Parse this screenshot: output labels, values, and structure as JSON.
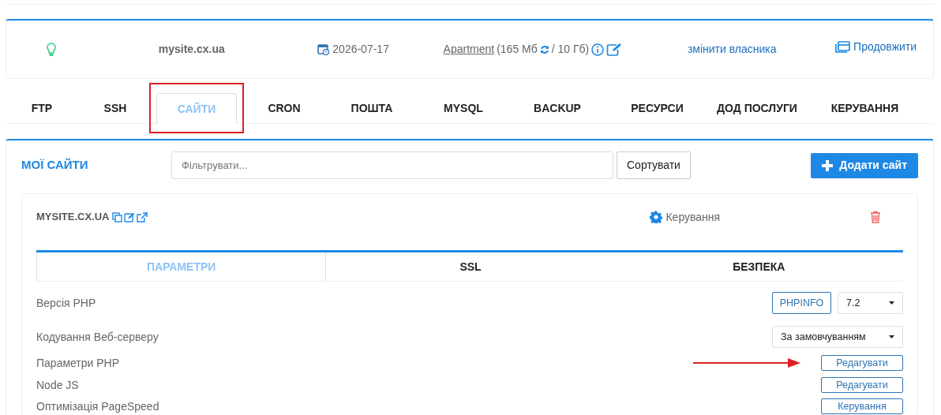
{
  "account": {
    "domain": "mysite.cx.ua",
    "expiry": "2026-07-17",
    "plan_link": "Apartment",
    "usage_used": "(165 Мб",
    "usage_total": "/ 10 Гб)",
    "owner_link": "змінити власника",
    "renew_link": "Продовжити"
  },
  "tabs": [
    {
      "label": "FTP",
      "selected": false,
      "highlighted": false
    },
    {
      "label": "SSH",
      "selected": false,
      "highlighted": false
    },
    {
      "label": "САЙТИ",
      "selected": true,
      "highlighted": true
    },
    {
      "label": "CRON",
      "selected": false,
      "highlighted": false
    },
    {
      "label": "ПОШТА",
      "selected": false,
      "highlighted": false
    },
    {
      "label": "MYSQL",
      "selected": false,
      "highlighted": false
    },
    {
      "label": "BACKUP",
      "selected": false,
      "highlighted": false
    },
    {
      "label": "РЕСУРСИ",
      "selected": false,
      "highlighted": false
    },
    {
      "label": "ДОД ПОСЛУГИ",
      "selected": false,
      "highlighted": false
    },
    {
      "label": "КЕРУВАННЯ",
      "selected": false,
      "highlighted": false
    }
  ],
  "sites_panel": {
    "title": "МОЇ САЙТИ",
    "filter_placeholder": "Фільтрувати...",
    "sort_button": "Сортувати",
    "add_button": "Додати сайт"
  },
  "site": {
    "name": "MYSITE.CX.UA",
    "manage_link": "Керування",
    "tabs": [
      {
        "label": "ПАРАМЕТРИ",
        "selected": true
      },
      {
        "label": "SSL",
        "selected": false
      },
      {
        "label": "БЕЗПЕКА",
        "selected": false
      }
    ],
    "settings": [
      {
        "label": "Версія PHP",
        "kind": "info_select",
        "button": "PHPINFO",
        "value": "7.2",
        "arrow": false
      },
      {
        "label": "Кодування Веб-серверу",
        "kind": "select",
        "value": "За замовчуванням",
        "arrow": false
      },
      {
        "label": "Параметри PHP",
        "kind": "button",
        "button": "Редагувати",
        "arrow": true
      },
      {
        "label": "Node JS",
        "kind": "button",
        "button": "Редагувати",
        "arrow": false
      },
      {
        "label": "Оптимізація PageSpeed",
        "kind": "button",
        "button": "Керування",
        "arrow": false
      }
    ]
  }
}
